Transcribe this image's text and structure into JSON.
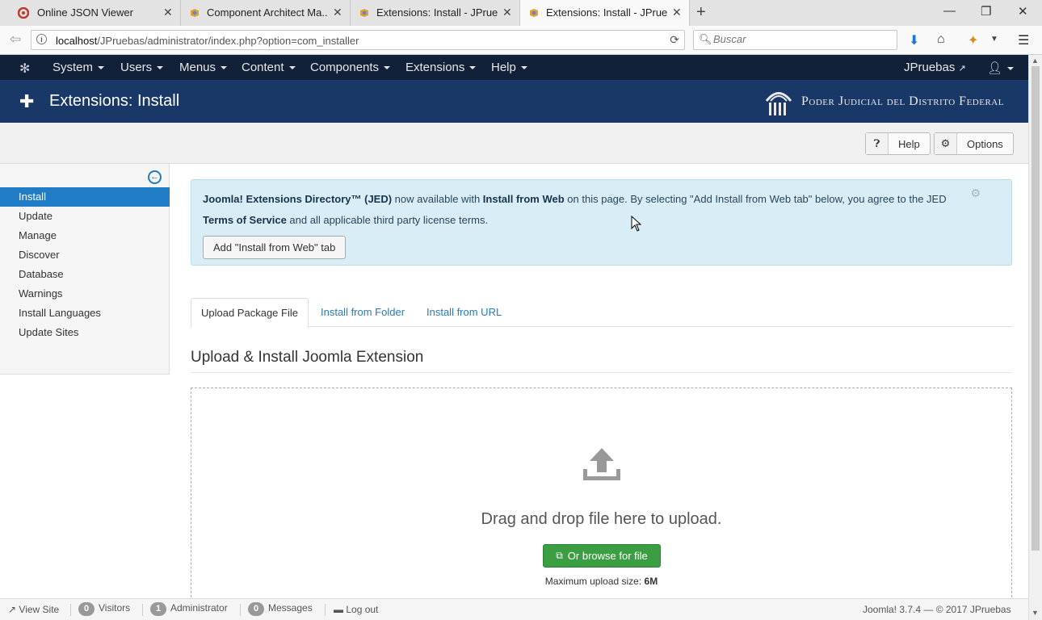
{
  "browser": {
    "tabs": [
      {
        "title": "Online JSON Viewer",
        "icon": "json-viewer-icon",
        "active": false
      },
      {
        "title": "Component Architect Ma...",
        "icon": "joomla-icon",
        "active": false
      },
      {
        "title": "Extensions: Install - JPrueb...",
        "icon": "joomla-icon",
        "active": false
      },
      {
        "title": "Extensions: Install - JPrueb...",
        "icon": "joomla-icon",
        "active": true
      }
    ],
    "url_host": "localhost",
    "url_path": "/JPruebas/administrator/index.php?option=com_installer",
    "search_placeholder": "Buscar"
  },
  "joomla": {
    "menu": [
      {
        "label": "System"
      },
      {
        "label": "Users"
      },
      {
        "label": "Menus"
      },
      {
        "label": "Content"
      },
      {
        "label": "Components"
      },
      {
        "label": "Extensions"
      },
      {
        "label": "Help"
      }
    ],
    "site_link": "JPruebas",
    "page_title": "Extensions: Install",
    "brand": "Poder Judicial del Distrito Federal",
    "toolbar": {
      "help": "Help",
      "options": "Options"
    },
    "sidebar": [
      {
        "label": "Install",
        "active": true
      },
      {
        "label": "Update",
        "active": false
      },
      {
        "label": "Manage",
        "active": false
      },
      {
        "label": "Discover",
        "active": false
      },
      {
        "label": "Database",
        "active": false
      },
      {
        "label": "Warnings",
        "active": false
      },
      {
        "label": "Install Languages",
        "active": false
      },
      {
        "label": "Update Sites",
        "active": false
      }
    ],
    "alert": {
      "jed": "Joomla! Extensions Directory™ (JED)",
      "t1": " now available with ",
      "install_from_web": "Install from Web",
      "t2": " on this page. By selecting \"Add Install from Web tab\" below, you agree to the JED ",
      "terms": "Terms of Service",
      "t3": " and all applicable third party license terms.",
      "button": "Add \"Install from Web\" tab"
    },
    "tabs": [
      {
        "label": "Upload Package File",
        "active": true
      },
      {
        "label": "Install from Folder",
        "active": false
      },
      {
        "label": "Install from URL",
        "active": false
      }
    ],
    "section_title": "Upload & Install Joomla Extension",
    "dropzone": {
      "text": "Drag and drop file here to upload.",
      "browse": "Or browse for file",
      "max_label": "Maximum upload size: ",
      "max_value": "6M"
    },
    "status": {
      "view_site": "View Site",
      "visitors_count": "0",
      "visitors": "Visitors",
      "admin_count": "1",
      "admin": "Administrator",
      "messages_count": "0",
      "messages": "Messages",
      "logout": "Log out",
      "version": "Joomla! 3.7.4 — © 2017 JPruebas"
    }
  },
  "colors": {
    "nav_bg": "#12213a",
    "header_bg": "#1a3867",
    "sidebar_active": "#1f7cc5",
    "alert_bg": "#d9edf7",
    "browse_btn": "#3c9e43",
    "link": "#2a7ab6"
  }
}
